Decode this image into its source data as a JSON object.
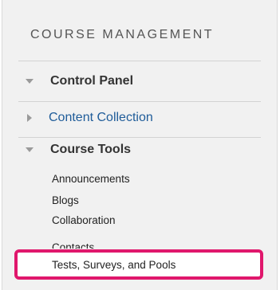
{
  "header": {
    "title": "COURSE MANAGEMENT"
  },
  "sections": [
    {
      "label": "Control Panel",
      "state": "expanded"
    },
    {
      "label": "Content Collection",
      "state": "collapsed"
    },
    {
      "label": "Course Tools",
      "state": "expanded"
    }
  ],
  "course_tools": {
    "items": [
      "Announcements",
      "Blogs",
      "Collaboration",
      "Contacts",
      "Tests, Surveys, and Pools"
    ]
  },
  "icons": {
    "expanded": "triangle-down-icon",
    "collapsed": "triangle-right-icon"
  },
  "colors": {
    "highlight_border": "#e0176c",
    "link": "#1f5c99"
  }
}
